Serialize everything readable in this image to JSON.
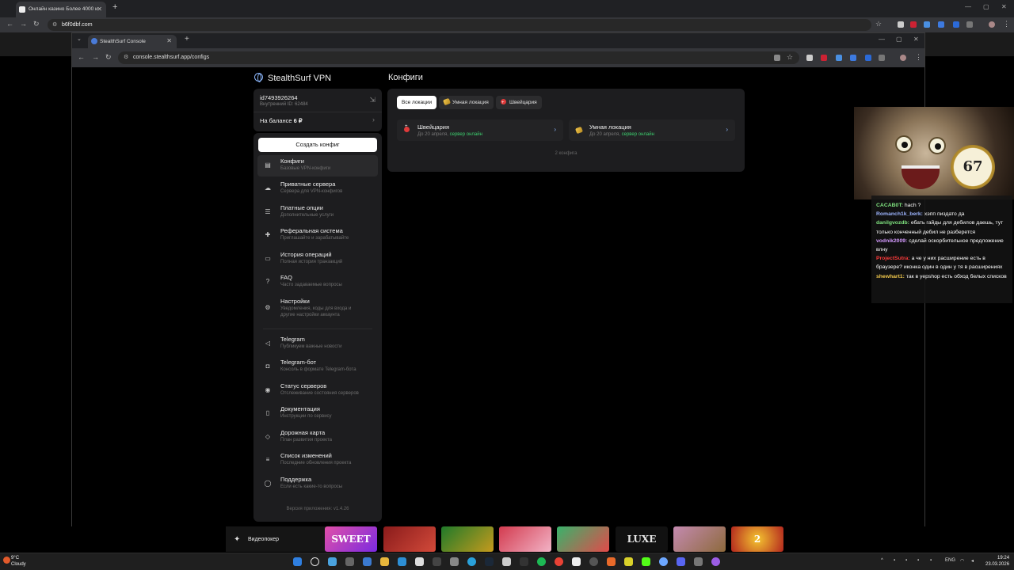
{
  "outer_browser": {
    "tab_title": "Онлайн казино Более 4000 и",
    "url": "b6f0dbf.com"
  },
  "inner_browser": {
    "tab_title": "StealthSurf Console",
    "url": "console.stealthsurf.app/configs"
  },
  "app": {
    "brand": "StealthSurf VPN",
    "account": {
      "id": "id7493926264",
      "internal_id": "Внутренний ID: 62484",
      "balance_label": "На балансе",
      "balance_value": "6 ₽"
    },
    "create_button": "Создать конфиг",
    "menu": [
      {
        "title": "Конфиги",
        "subtitle": "Базовые VPN-конфиги",
        "icon": "configs-icon"
      },
      {
        "title": "Приватные сервера",
        "subtitle": "Сервера для VPN-конфигов",
        "icon": "cloud-icon"
      },
      {
        "title": "Платные опции",
        "subtitle": "Дополнительные услуги",
        "icon": "options-icon"
      },
      {
        "title": "Реферальная система",
        "subtitle": "Приглашайте и зарабатывайте",
        "icon": "user-plus-icon"
      },
      {
        "title": "История операций",
        "subtitle": "Полная история транзакций",
        "icon": "wallet-icon"
      },
      {
        "title": "FAQ",
        "subtitle": "Часто задаваемые вопросы",
        "icon": "faq-icon"
      },
      {
        "title": "Настройки",
        "subtitle": "Уведомления, коды для входа и",
        "subtitle2": "другие настройки аккаунта",
        "icon": "gear-icon"
      }
    ],
    "menu_secondary": [
      {
        "title": "Telegram",
        "subtitle": "Публикуем важные новости",
        "icon": "megaphone-icon"
      },
      {
        "title": "Telegram-бот",
        "subtitle": "Консоль в формате Telegram-бота",
        "icon": "bot-icon"
      },
      {
        "title": "Статус серверов",
        "subtitle": "Отслеживание состояния серверов",
        "icon": "broadcast-icon"
      },
      {
        "title": "Документация",
        "subtitle": "Инструкции по сервису",
        "icon": "document-icon"
      },
      {
        "title": "Дорожная карта",
        "subtitle": "План развития проекта",
        "icon": "map-icon"
      },
      {
        "title": "Список изменений",
        "subtitle": "Последние обновления проекта",
        "icon": "changelog-icon"
      },
      {
        "title": "Поддержка",
        "subtitle": "Если есть какие-то вопросы",
        "icon": "chat-icon"
      }
    ],
    "version": "Версия приложения: v1.4.26",
    "main_title": "Конфиги",
    "filters": [
      "Все локации",
      "Умная локация",
      "Швейцария"
    ],
    "configs": [
      {
        "name": "Швейцария",
        "until": "До 20 апреля,",
        "status": "сервер онлайн"
      },
      {
        "name": "Умная локация",
        "until": "До 20 апреля,",
        "status": "сервер онлайн"
      }
    ],
    "count_label": "2 конфига"
  },
  "overlay": {
    "watch_text": "67",
    "chat": [
      {
        "user": "CACAB0T:",
        "color": "#7fe27f",
        "text": "hach ?"
      },
      {
        "user": "Romanch1k_berk:",
        "color": "#9db5ff",
        "text": "хэпп пиздато да"
      },
      {
        "user": "danilgvozdb:",
        "color": "#7fe27f",
        "text": "ебать гайды для дебилов даешь, тут только конченный дебил не разберется"
      },
      {
        "user": "vodnik2009:",
        "color": "#d59bff",
        "text": "сделай оскорбительное предложение влну"
      },
      {
        "user": "ProjectSutra:",
        "color": "#ff3b3b",
        "text": "а че у них расширение есть в браузере? иконка один в один у тя в расширениях"
      },
      {
        "user": "shewhart1:",
        "color": "#f2c94c",
        "text": "так в yepshop есть обход белых списков"
      }
    ]
  },
  "desktop": {
    "widget_label": "Видеопокер",
    "slots": [
      "SWEET",
      "",
      "",
      "",
      "",
      "LUXE",
      "",
      "2"
    ],
    "weather_temp": "9°C",
    "weather_desc": "Cloudy",
    "lang": "ENG",
    "time": "19:24",
    "date": "23.03.2026"
  }
}
